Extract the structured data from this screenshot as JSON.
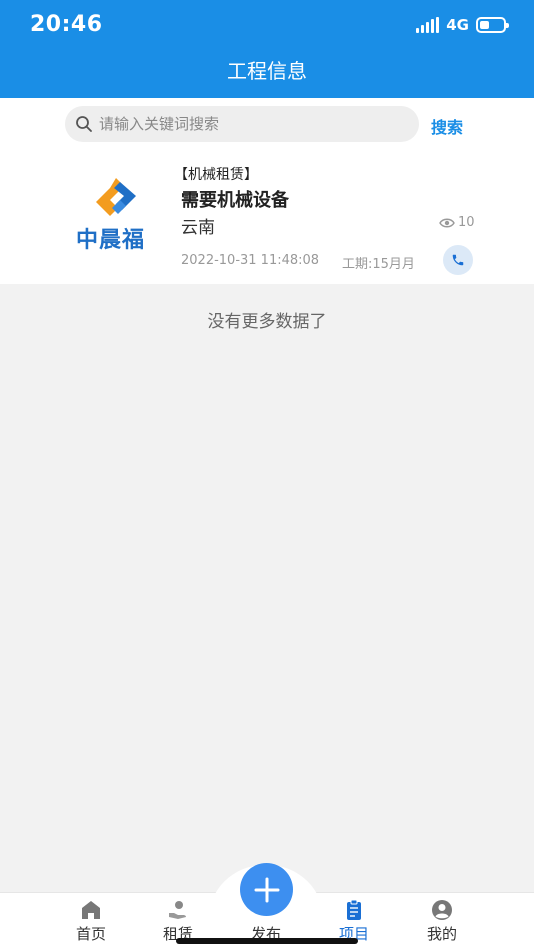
{
  "status_bar": {
    "time": "20:46",
    "network": "4G"
  },
  "header": {
    "title": "工程信息"
  },
  "search": {
    "placeholder": "请输入关键词搜索",
    "button_label": "搜索"
  },
  "projects": [
    {
      "logo_text": "中晨福",
      "category": "【机械租赁】",
      "title": "需要机械设备",
      "region": "云南",
      "views": "10",
      "date": "2022-10-31 11:48:08",
      "period": "工期:15月月"
    }
  ],
  "list_footer": "没有更多数据了",
  "tabbar": {
    "items": [
      {
        "label": "首页",
        "icon": "home-icon"
      },
      {
        "label": "租赁",
        "icon": "rental-icon"
      },
      {
        "label": "发布",
        "icon": "plus-icon"
      },
      {
        "label": "项目",
        "icon": "clipboard-icon"
      },
      {
        "label": "我的",
        "icon": "profile-icon"
      }
    ]
  },
  "colors": {
    "primary": "#1a8ee6",
    "active_tab": "#1a6fd4",
    "fab": "#3d8ff0",
    "logo_blue": "#1f6fc6",
    "logo_orange": "#f39c1f"
  }
}
